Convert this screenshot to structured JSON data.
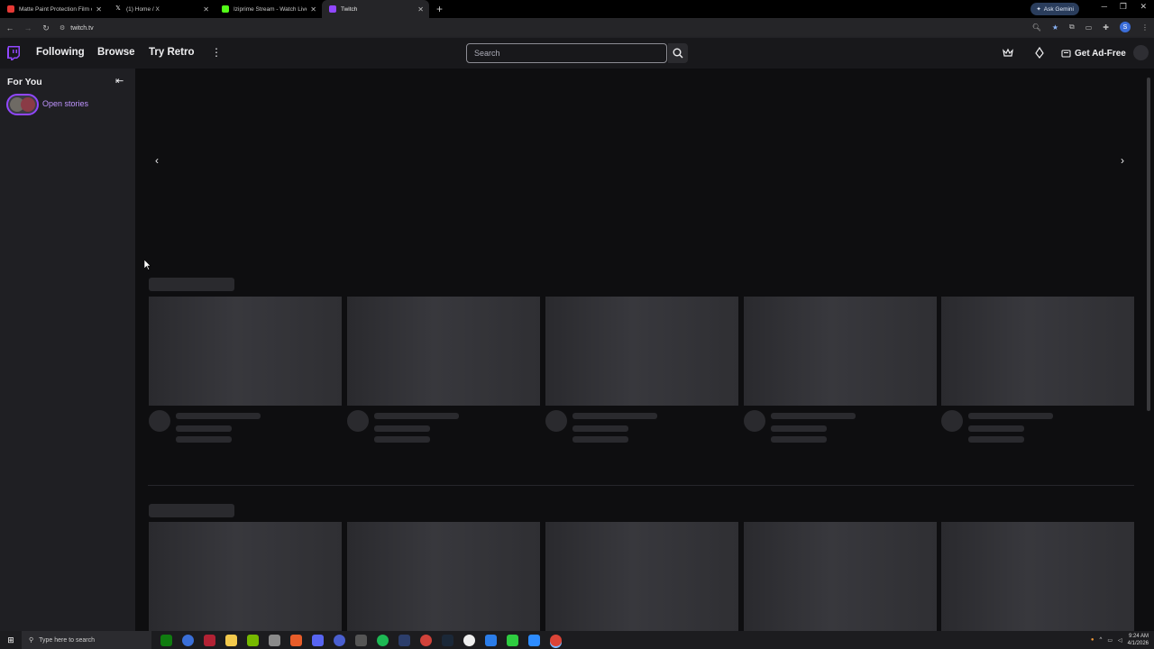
{
  "browser": {
    "tabs": [
      {
        "title": "Matte Paint Protection Film on",
        "favicon_color": "#e53935"
      },
      {
        "title": "(1) Home / X",
        "favicon_color": "#ffffff"
      },
      {
        "title": "Iziprime Stream - Watch Live o",
        "favicon_color": "#53fc18"
      },
      {
        "title": "Twitch",
        "favicon_color": "#9147ff"
      }
    ],
    "active_tab": 3,
    "gemini_label": "Ask Gemini",
    "url": "twitch.tv",
    "profile_letter": "S"
  },
  "twitch": {
    "nav": {
      "following": "Following",
      "browse": "Browse",
      "try_retro": "Try Retro",
      "search_placeholder": "Search",
      "get_ad_free": "Get Ad-Free"
    },
    "sidebar": {
      "title": "For You",
      "open_stories": "Open stories"
    },
    "colors": {
      "brand": "#9147ff",
      "accent_text": "#bf94ff",
      "background": "#0e0e10"
    }
  },
  "taskbar": {
    "search_placeholder": "Type here to search",
    "time": "9:24 AM",
    "date": "4/1/2026"
  }
}
